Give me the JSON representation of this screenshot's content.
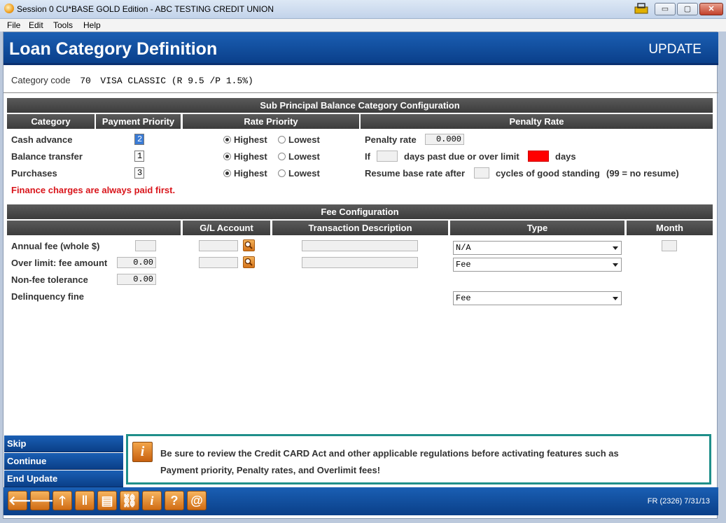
{
  "window": {
    "title": "Session 0 CU*BASE GOLD Edition - ABC TESTING CREDIT UNION",
    "min_label": "▭",
    "max_label": "▢",
    "close_label": "✕"
  },
  "menu": [
    "File",
    "Edit",
    "Tools",
    "Help"
  ],
  "header": {
    "title": "Loan Category Definition",
    "mode": "UPDATE"
  },
  "category": {
    "label": "Category code",
    "code": "70",
    "description": "VISA CLASSIC (R 9.5 /P 1.5%)"
  },
  "sub_principal": {
    "section_title": "Sub Principal Balance Category Configuration",
    "columns": {
      "category": "Category",
      "payment_priority": "Payment Priority",
      "rate_priority": "Rate Priority",
      "penalty_rate": "Penalty Rate"
    },
    "rows": [
      {
        "label": "Cash advance",
        "priority": "2",
        "highest": "Highest",
        "lowest": "Lowest"
      },
      {
        "label": "Balance transfer",
        "priority": "1",
        "highest": "Highest",
        "lowest": "Lowest"
      },
      {
        "label": "Purchases",
        "priority": "3",
        "highest": "Highest",
        "lowest": "Lowest"
      }
    ],
    "penalty": {
      "rate_label": "Penalty rate",
      "rate_value": "0.000",
      "if_label": "If",
      "days_label": "days past due or over limit",
      "days_suffix": "days",
      "resume_label": "Resume base rate after",
      "cycles_label": "cycles of good standing",
      "resume_hint": "(99 = no resume)"
    },
    "warning": "Finance charges are always paid first."
  },
  "fee": {
    "section_title": "Fee Configuration",
    "columns": {
      "gl": "G/L Account",
      "description": "Transaction Description",
      "type": "Type",
      "month": "Month"
    },
    "annual_fee_label": "Annual fee (whole $)",
    "annual_type": "N/A",
    "over_limit_label": "Over limit: fee amount",
    "over_limit_value": "0.00",
    "over_limit_type": "Fee",
    "tolerance_label": "Non-fee tolerance",
    "tolerance_value": "0.00",
    "delinquency_label": "Delinquency fine",
    "delinquency_type": "Fee"
  },
  "nav": {
    "skip": "Skip",
    "continue": "Continue",
    "end_update": "End Update"
  },
  "notice": {
    "line1": "Be sure to review the Credit CARD Act and other applicable regulations before activating features such as",
    "line2": "Payment priority, Penalty rates, and Overlimit fees!"
  },
  "toolbar": {
    "buttons": {
      "back": "🡐",
      "forward": "🡒",
      "up": "🡑",
      "pause": "‖",
      "print": "▤",
      "link": "⛓",
      "info": "i",
      "help": "?",
      "email": "@"
    },
    "code": "FR (2326) 7/31/13"
  },
  "colors": {
    "header_blue": "#0a3f8a",
    "warning_red": "#d9151b",
    "notice_border": "#1f8f8a",
    "button_orange": "#d06c14"
  }
}
